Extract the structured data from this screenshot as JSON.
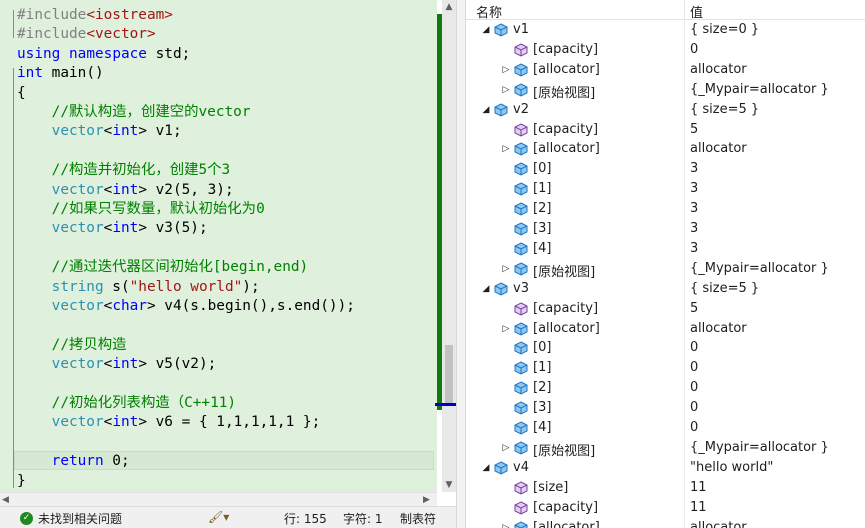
{
  "editor": {
    "lines": [
      "#include<iostream>",
      "#include<vector>",
      "using namespace std;",
      "int main()",
      "{",
      "    //默认构造，创建空的vector",
      "    vector<int> v1;",
      "",
      "    //构造并初始化，创建5个3",
      "    vector<int> v2(5, 3);",
      "    //如果只写数量，默认初始化为0",
      "    vector<int> v3(5);",
      "",
      "    //通过迭代器区间初始化[begin,end)",
      "    string s(\"hello world\");",
      "    vector<char> v4(s.begin(),s.end());",
      "",
      "    //拷贝构造",
      "    vector<int> v5(v2);",
      "",
      "    //初始化列表构造（C++11)",
      "    vector<int> v6 = { 1,1,1,1,1 };",
      "",
      "    return 0;",
      "}"
    ],
    "colors": {
      "background": "#dff0dc",
      "keyword": "#0000ff",
      "preprocessor": "#808080",
      "string": "#a31515",
      "comment": "#008000",
      "type": "#2b91af",
      "change_bar": "#107c10"
    }
  },
  "statusbar": {
    "issues_text": "未找到相关问题",
    "issues_icon": "check-circle-icon",
    "brush_icon": "code-cleanup-brush-icon",
    "line_text": "行: 155",
    "char_text": "字符: 1",
    "tab_mode": "制表符"
  },
  "watch": {
    "columns": {
      "name": "名称",
      "value": "值"
    },
    "rows": [
      {
        "depth": 0,
        "expander": "expanded",
        "icon": "object-icon",
        "name": "v1",
        "value": "{ size=0 }"
      },
      {
        "depth": 1,
        "expander": "none",
        "icon": "member-icon",
        "name": "[capacity]",
        "value": "0"
      },
      {
        "depth": 1,
        "expander": "collapsed",
        "icon": "object-icon",
        "name": "[allocator]",
        "value": "allocator"
      },
      {
        "depth": 1,
        "expander": "collapsed",
        "icon": "object-icon",
        "name": "[原始视图]",
        "value": "{_Mypair=allocator }"
      },
      {
        "depth": 0,
        "expander": "expanded",
        "icon": "object-icon",
        "name": "v2",
        "value": "{ size=5 }"
      },
      {
        "depth": 1,
        "expander": "none",
        "icon": "member-icon",
        "name": "[capacity]",
        "value": "5"
      },
      {
        "depth": 1,
        "expander": "collapsed",
        "icon": "object-icon",
        "name": "[allocator]",
        "value": "allocator"
      },
      {
        "depth": 1,
        "expander": "none",
        "icon": "object-icon",
        "name": "[0]",
        "value": "3"
      },
      {
        "depth": 1,
        "expander": "none",
        "icon": "object-icon",
        "name": "[1]",
        "value": "3"
      },
      {
        "depth": 1,
        "expander": "none",
        "icon": "object-icon",
        "name": "[2]",
        "value": "3"
      },
      {
        "depth": 1,
        "expander": "none",
        "icon": "object-icon",
        "name": "[3]",
        "value": "3"
      },
      {
        "depth": 1,
        "expander": "none",
        "icon": "object-icon",
        "name": "[4]",
        "value": "3"
      },
      {
        "depth": 1,
        "expander": "collapsed",
        "icon": "object-icon",
        "name": "[原始视图]",
        "value": "{_Mypair=allocator }"
      },
      {
        "depth": 0,
        "expander": "expanded",
        "icon": "object-icon",
        "name": "v3",
        "value": "{ size=5 }"
      },
      {
        "depth": 1,
        "expander": "none",
        "icon": "member-icon",
        "name": "[capacity]",
        "value": "5"
      },
      {
        "depth": 1,
        "expander": "collapsed",
        "icon": "object-icon",
        "name": "[allocator]",
        "value": "allocator"
      },
      {
        "depth": 1,
        "expander": "none",
        "icon": "object-icon",
        "name": "[0]",
        "value": "0"
      },
      {
        "depth": 1,
        "expander": "none",
        "icon": "object-icon",
        "name": "[1]",
        "value": "0"
      },
      {
        "depth": 1,
        "expander": "none",
        "icon": "object-icon",
        "name": "[2]",
        "value": "0"
      },
      {
        "depth": 1,
        "expander": "none",
        "icon": "object-icon",
        "name": "[3]",
        "value": "0"
      },
      {
        "depth": 1,
        "expander": "none",
        "icon": "object-icon",
        "name": "[4]",
        "value": "0"
      },
      {
        "depth": 1,
        "expander": "collapsed",
        "icon": "object-icon",
        "name": "[原始视图]",
        "value": "{_Mypair=allocator }"
      },
      {
        "depth": 0,
        "expander": "expanded",
        "icon": "object-icon",
        "name": "v4",
        "value": "\"hello world\""
      },
      {
        "depth": 1,
        "expander": "none",
        "icon": "member-icon",
        "name": "[size]",
        "value": "11"
      },
      {
        "depth": 1,
        "expander": "none",
        "icon": "member-icon",
        "name": "[capacity]",
        "value": "11"
      },
      {
        "depth": 1,
        "expander": "collapsed",
        "icon": "object-icon",
        "name": "[allocator]",
        "value": "allocator"
      }
    ]
  }
}
